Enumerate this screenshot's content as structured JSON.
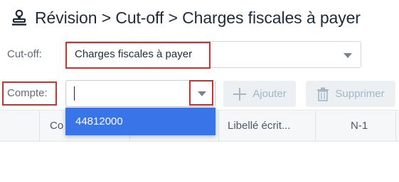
{
  "breadcrumb": {
    "icon": "stamp-icon",
    "text": "Révision > Cut-off > Charges fiscales à payer"
  },
  "cutoff": {
    "label": "Cut-off:",
    "value": "Charges fiscales à payer"
  },
  "compte": {
    "label": "Compte:",
    "value": "",
    "options": [
      "44812000"
    ]
  },
  "toolbar": {
    "add_label": "Ajouter",
    "delete_label": "Supprimer"
  },
  "grid": {
    "columns": [
      "Co",
      "Libellé écrit...",
      "N-1"
    ]
  },
  "colors": {
    "accent": "#3a74e9",
    "highlight": "#d62d2d",
    "disabled_text": "#a4b5c8"
  }
}
